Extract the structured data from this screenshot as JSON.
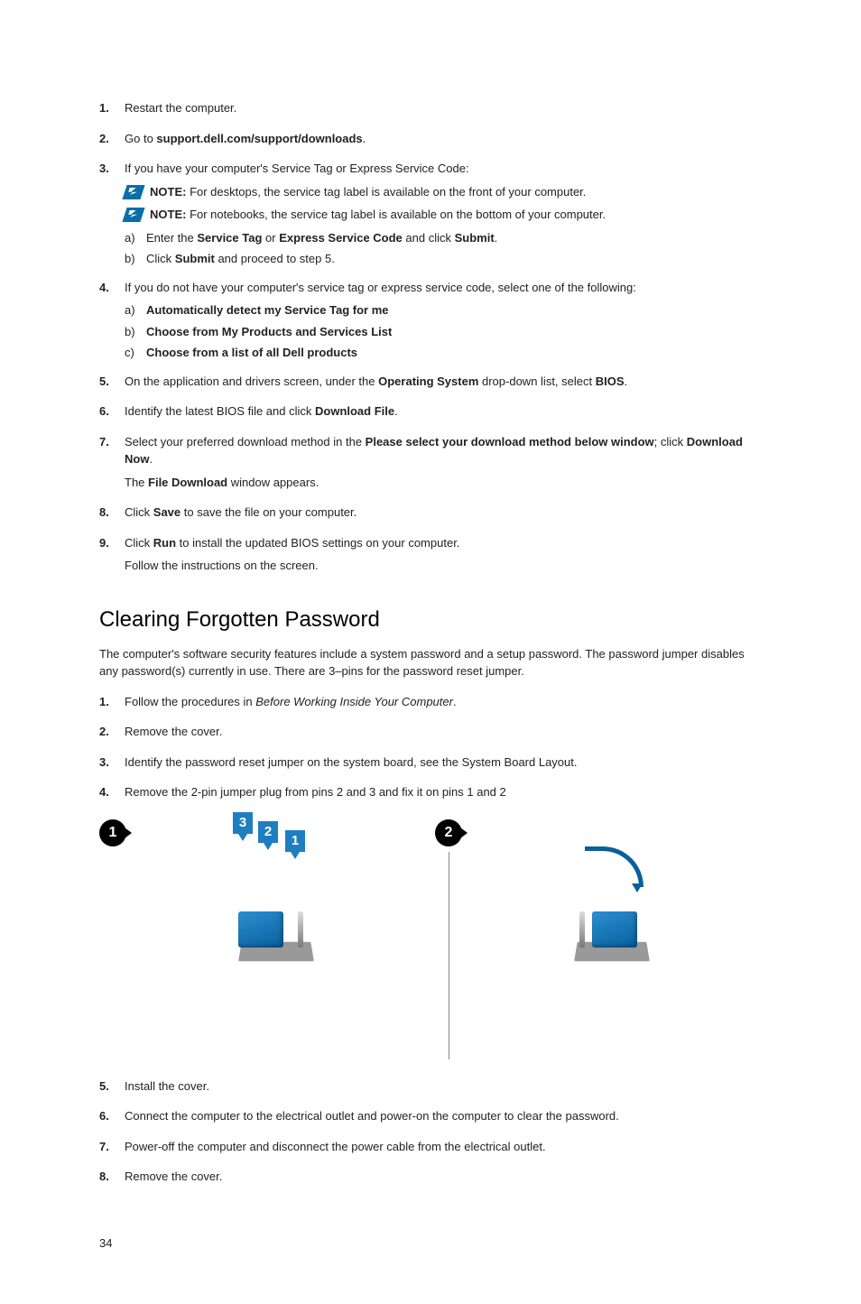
{
  "list1": [
    {
      "num": "1.",
      "parts": [
        {
          "t": "Restart the computer."
        }
      ]
    },
    {
      "num": "2.",
      "parts": [
        {
          "t": "Go to "
        },
        {
          "t": "support.dell.com/support/downloads",
          "b": true
        },
        {
          "t": "."
        }
      ]
    },
    {
      "num": "3.",
      "parts": [
        {
          "t": "If you have your computer's Service Tag or Express Service Code:"
        }
      ],
      "notes": [
        {
          "label": "NOTE:",
          "text": "For desktops, the service tag label is available on the front of your computer."
        },
        {
          "label": "NOTE:",
          "text": "For notebooks, the service tag label is available on the bottom of your computer."
        }
      ],
      "sub": [
        {
          "n": "a)",
          "parts": [
            {
              "t": "Enter the "
            },
            {
              "t": "Service Tag",
              "b": true
            },
            {
              "t": " or "
            },
            {
              "t": "Express Service Code",
              "b": true
            },
            {
              "t": " and click "
            },
            {
              "t": "Submit",
              "b": true
            },
            {
              "t": "."
            }
          ]
        },
        {
          "n": "b)",
          "parts": [
            {
              "t": "Click "
            },
            {
              "t": "Submit",
              "b": true
            },
            {
              "t": " and proceed to step 5."
            }
          ]
        }
      ]
    },
    {
      "num": "4.",
      "parts": [
        {
          "t": "If you do not have your computer's service tag or express service code, select one of the following:"
        }
      ],
      "sub": [
        {
          "n": "a)",
          "parts": [
            {
              "t": "Automatically detect my Service Tag for me",
              "b": true
            }
          ]
        },
        {
          "n": "b)",
          "parts": [
            {
              "t": "Choose from My Products and Services List",
              "b": true
            }
          ]
        },
        {
          "n": "c)",
          "parts": [
            {
              "t": "Choose from a list of all Dell products",
              "b": true
            }
          ]
        }
      ]
    },
    {
      "num": "5.",
      "parts": [
        {
          "t": "On the application and drivers screen, under the "
        },
        {
          "t": "Operating System",
          "b": true
        },
        {
          "t": " drop-down list, select "
        },
        {
          "t": "BIOS",
          "b": true
        },
        {
          "t": "."
        }
      ]
    },
    {
      "num": "6.",
      "parts": [
        {
          "t": "Identify the latest BIOS file and click "
        },
        {
          "t": "Download File",
          "b": true
        },
        {
          "t": "."
        }
      ]
    },
    {
      "num": "7.",
      "parts": [
        {
          "t": "Select your preferred download method in the "
        },
        {
          "t": "Please select your download method below window",
          "b": true
        },
        {
          "t": "; click "
        },
        {
          "t": "Download Now",
          "b": true
        },
        {
          "t": "."
        }
      ],
      "after": [
        {
          "t": "The "
        },
        {
          "t": "File Download",
          "b": true
        },
        {
          "t": " window appears."
        }
      ]
    },
    {
      "num": "8.",
      "parts": [
        {
          "t": "Click "
        },
        {
          "t": "Save",
          "b": true
        },
        {
          "t": " to save the file on your computer."
        }
      ]
    },
    {
      "num": "9.",
      "parts": [
        {
          "t": "Click "
        },
        {
          "t": "Run",
          "b": true
        },
        {
          "t": " to install the updated BIOS settings on your computer."
        }
      ],
      "after": [
        {
          "t": "Follow the instructions on the screen."
        }
      ]
    }
  ],
  "heading": "Clearing Forgotten Password",
  "paragraph": "The computer's software security features include a system password and a setup password. The password jumper disables any password(s) currently in use. There are 3–pins for the password reset jumper.",
  "list2a": [
    {
      "num": "1.",
      "parts": [
        {
          "t": "Follow the procedures in "
        },
        {
          "t": "Before Working Inside Your Computer",
          "i": true
        },
        {
          "t": "."
        }
      ]
    },
    {
      "num": "2.",
      "parts": [
        {
          "t": "Remove the cover."
        }
      ]
    },
    {
      "num": "3.",
      "parts": [
        {
          "t": "Identify the password reset jumper on the system board, see the System Board Layout."
        }
      ]
    },
    {
      "num": "4.",
      "parts": [
        {
          "t": "Remove the 2-pin jumper plug from pins 2 and 3 and fix it on pins 1 and 2"
        }
      ]
    }
  ],
  "figure": {
    "badge1": "1",
    "badge2": "2",
    "pin_labels": [
      "3",
      "2",
      "1"
    ]
  },
  "list2b": [
    {
      "num": "5.",
      "parts": [
        {
          "t": "Install the cover."
        }
      ]
    },
    {
      "num": "6.",
      "parts": [
        {
          "t": "Connect the computer to the electrical outlet and power-on the computer to clear the password."
        }
      ]
    },
    {
      "num": "7.",
      "parts": [
        {
          "t": "Power-off the computer and disconnect the power cable from the electrical outlet."
        }
      ]
    },
    {
      "num": "8.",
      "parts": [
        {
          "t": "Remove the cover."
        }
      ]
    }
  ],
  "page_num": "34"
}
